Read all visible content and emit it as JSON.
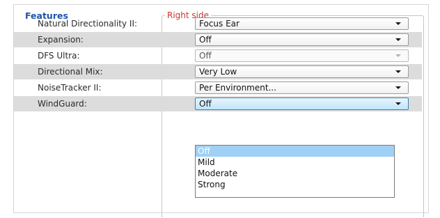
{
  "features_heading": "Features",
  "group_legend": "Right side",
  "rows": [
    {
      "label": "Natural Directionality II:",
      "value": "Focus Ear"
    },
    {
      "label": "Expansion:",
      "value": "Off"
    },
    {
      "label": "DFS Ultra:",
      "value": "Off"
    },
    {
      "label": "Directional Mix:",
      "value": "Very Low"
    },
    {
      "label": "NoiseTracker II:",
      "value": "Per Environment..."
    },
    {
      "label": "WindGuard:",
      "value": "Off"
    }
  ],
  "dropdown": {
    "options": [
      "Off",
      "Mild",
      "Moderate",
      "Strong"
    ],
    "selected": "Off"
  },
  "colors": {
    "heading": "#1f55a8",
    "legend": "#c8342f",
    "row_shade": "#dcdcdc",
    "selection": "#9fd0f5"
  },
  "icons": {
    "combo_arrow": "chevron-down-icon"
  }
}
